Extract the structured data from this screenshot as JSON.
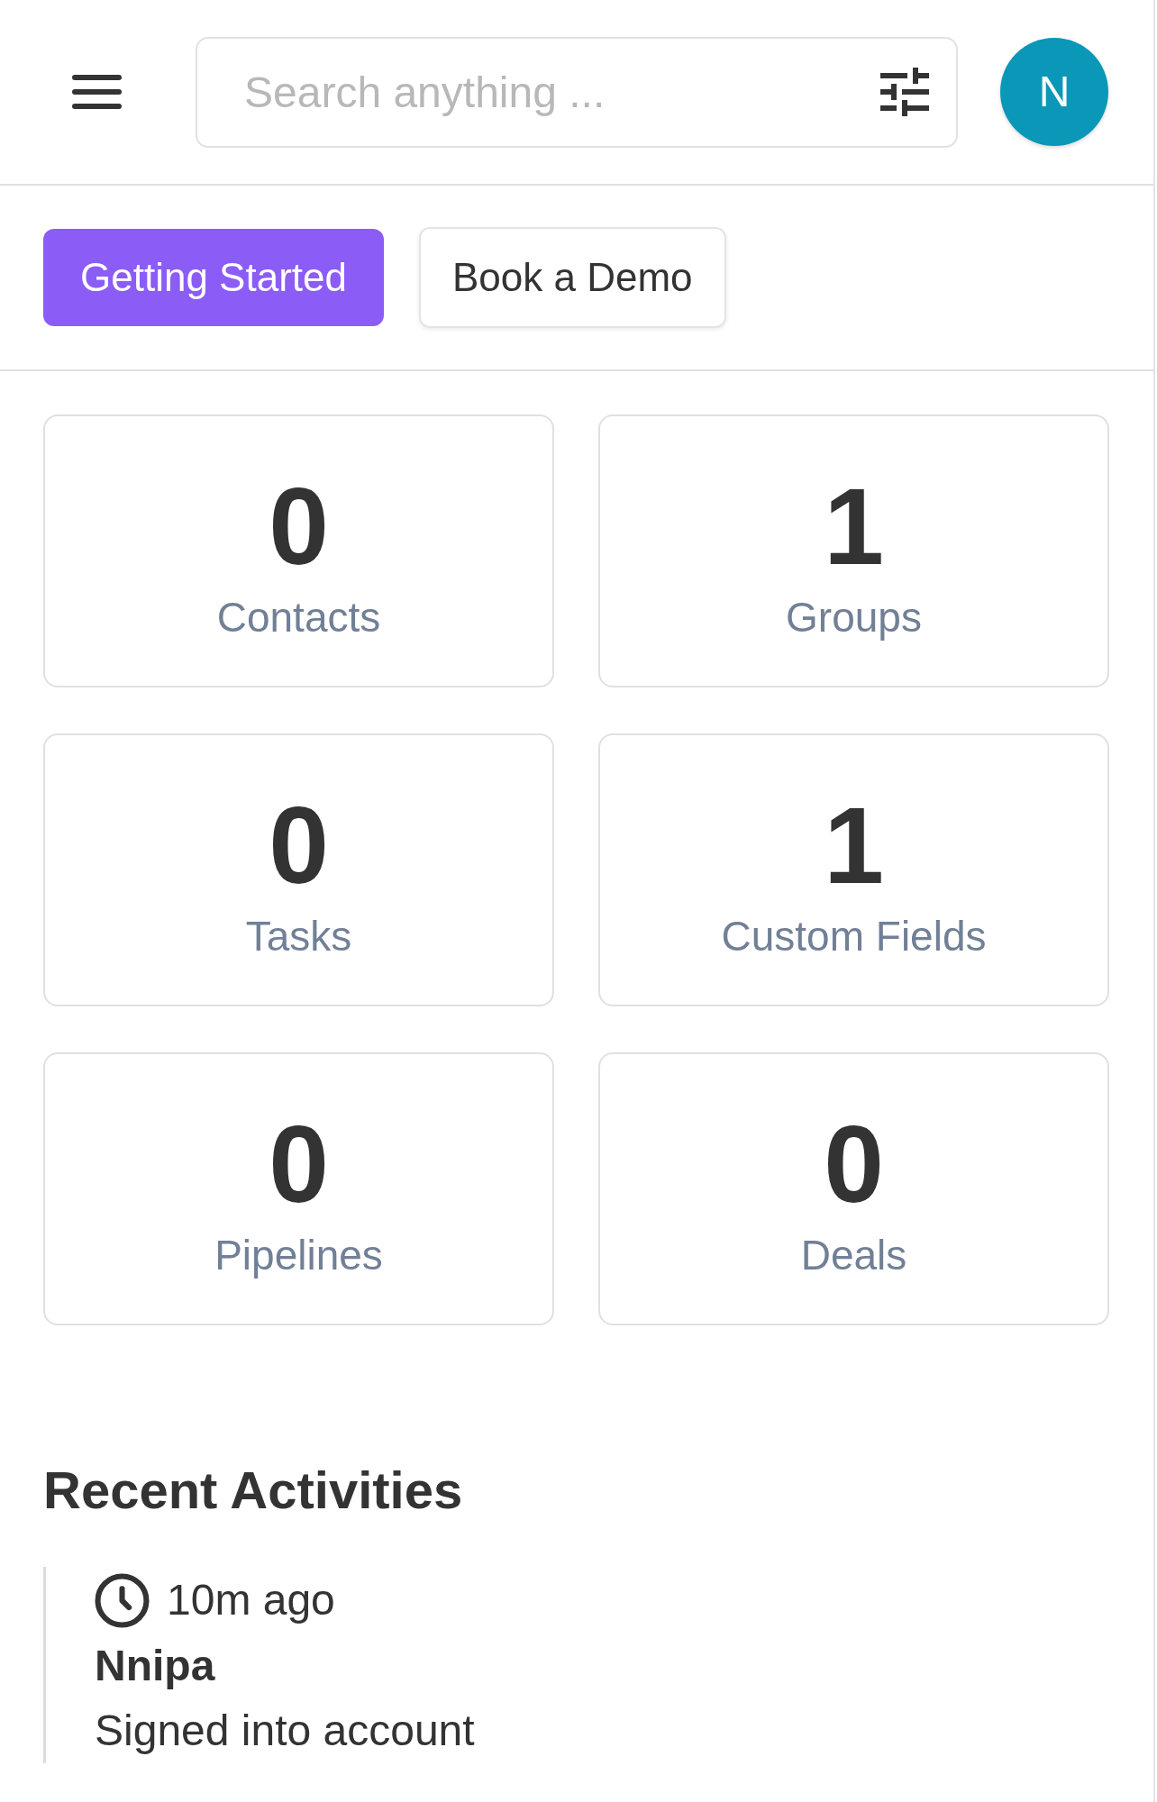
{
  "header": {
    "search": {
      "placeholder": "Search anything ..."
    },
    "avatar": {
      "initial": "N"
    }
  },
  "actions": [
    {
      "label": "Getting Started",
      "kind": "primary"
    },
    {
      "label": "Book a Demo",
      "kind": "outline"
    }
  ],
  "stats": [
    {
      "value": "0",
      "label": "Contacts"
    },
    {
      "value": "1",
      "label": "Groups"
    },
    {
      "value": "0",
      "label": "Tasks"
    },
    {
      "value": "1",
      "label": "Custom Fields"
    },
    {
      "value": "0",
      "label": "Pipelines"
    },
    {
      "value": "0",
      "label": "Deals"
    }
  ],
  "recent_activities": {
    "title": "Recent Activities",
    "items": [
      {
        "time": "10m ago",
        "user": "Nnipa",
        "action": "Signed into account"
      }
    ]
  }
}
